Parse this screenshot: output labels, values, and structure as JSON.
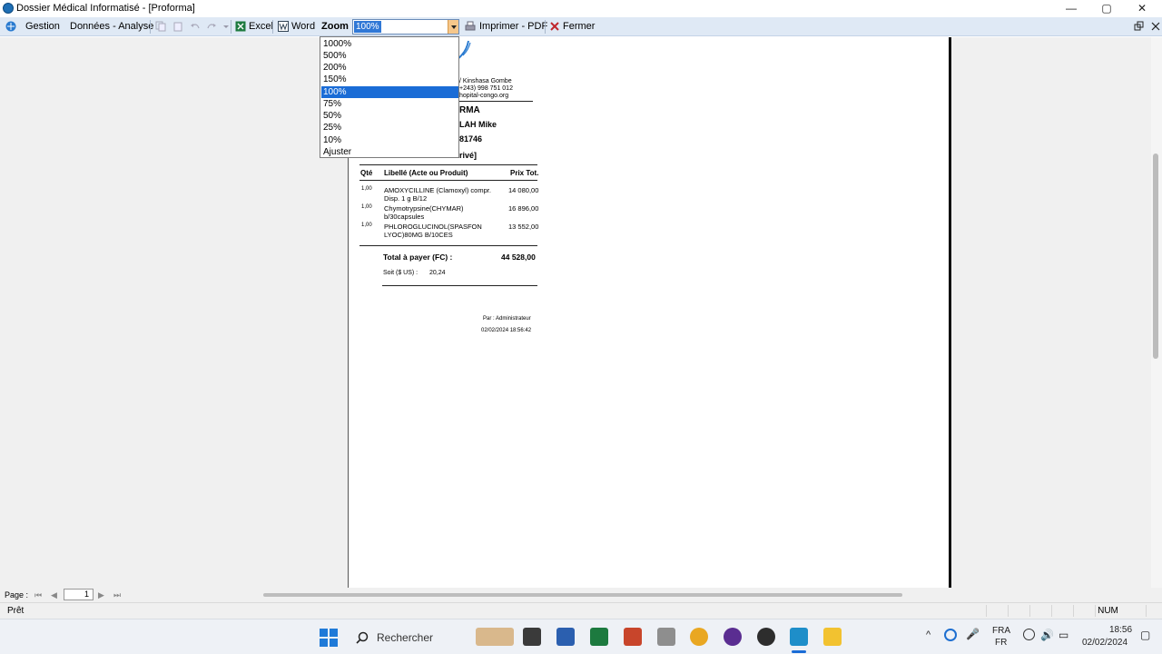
{
  "window": {
    "title": "Dossier Médical Informatisé - [Proforma]",
    "minimize": "—",
    "maximize": "▢",
    "close": "✕"
  },
  "toolbar": {
    "gestion": "Gestion",
    "donnees": "Données - Analyse",
    "excel": "Excel",
    "word": "Word",
    "zoom_label": "Zoom :",
    "zoom_value": "100%",
    "print": "Imprimer - PDF",
    "close": "Fermer"
  },
  "zoom_options": [
    "1000%",
    "500%",
    "200%",
    "150%",
    "100%",
    "75%",
    "50%",
    "25%",
    "10%",
    "Ajuster"
  ],
  "zoom_selected": "100%",
  "document": {
    "address": "/ Kinshasa Gombe",
    "phone": "+243) 998 751 012",
    "email": "hopital-congo.org",
    "heading": "RMA",
    "patient": "LAH Mike",
    "number": "81746",
    "category": "rivé]",
    "columns": {
      "qty": "Qté",
      "label": "Libellé (Acte ou Produit)",
      "price": "Prix Tot."
    },
    "rows": [
      {
        "qty": "1,00",
        "label1": "AMOXYCILLINE (Clamoxyl) compr.",
        "label2": "Disp. 1 g B/12",
        "price": "14 080,00"
      },
      {
        "qty": "1,00",
        "label1": "Chymotrypsine(CHYMAR)",
        "label2": "b/30capsules",
        "price": "16 896,00"
      },
      {
        "qty": "1,00",
        "label1": "PHLOROGLUCINOL(SPASFON",
        "label2": "LYOC)80MG B/10CES",
        "price": "13 552,00"
      }
    ],
    "total_label": "Total à payer (FC)   :",
    "total_value": "44 528,00",
    "usd_label": "Soit ($ US) :",
    "usd_value": "20,24",
    "by": "Par : Administrateur",
    "datetime": "02/02/2024 18:56:42"
  },
  "pagebar": {
    "label": "Page :",
    "page_number": "1"
  },
  "statusbar": {
    "text": "Prêt",
    "num": "NUM"
  },
  "taskbar": {
    "search": "Rechercher",
    "lang1": "FRA",
    "lang2": "FR",
    "time": "18:56",
    "date": "02/02/2024"
  },
  "colors": {
    "toolbar_bg": "#dfe9f5",
    "selection": "#1a6cd6",
    "taskbar_bg": "#eef1f6"
  }
}
